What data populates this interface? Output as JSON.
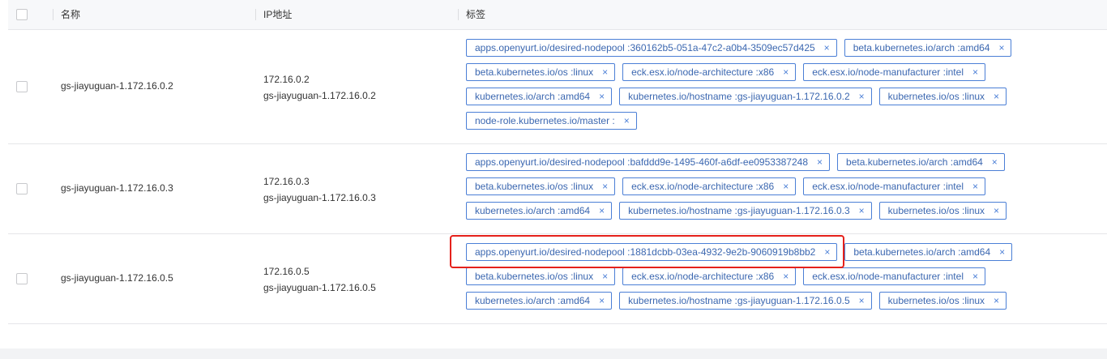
{
  "header": {
    "col_name": "名称",
    "col_ip": "IP地址",
    "col_tags": "标签"
  },
  "rows": [
    {
      "name": "gs-jiayuguan-1.172.16.0.2",
      "ip": "172.16.0.2",
      "hostname": "gs-jiayuguan-1.172.16.0.2",
      "tags": [
        "apps.openyurt.io/desired-nodepool :360162b5-051a-47c2-a0b4-3509ec57d425",
        "beta.kubernetes.io/arch :amd64",
        "beta.kubernetes.io/os :linux",
        "eck.esx.io/node-architecture :x86",
        "eck.esx.io/node-manufacturer :intel",
        "kubernetes.io/arch :amd64",
        "kubernetes.io/hostname :gs-jiayuguan-1.172.16.0.2",
        "kubernetes.io/os :linux",
        "node-role.kubernetes.io/master :"
      ]
    },
    {
      "name": "gs-jiayuguan-1.172.16.0.3",
      "ip": "172.16.0.3",
      "hostname": "gs-jiayuguan-1.172.16.0.3",
      "tags": [
        "apps.openyurt.io/desired-nodepool :bafddd9e-1495-460f-a6df-ee0953387248",
        "beta.kubernetes.io/arch :amd64",
        "beta.kubernetes.io/os :linux",
        "eck.esx.io/node-architecture :x86",
        "eck.esx.io/node-manufacturer :intel",
        "kubernetes.io/arch :amd64",
        "kubernetes.io/hostname :gs-jiayuguan-1.172.16.0.3",
        "kubernetes.io/os :linux"
      ]
    },
    {
      "name": "gs-jiayuguan-1.172.16.0.5",
      "ip": "172.16.0.5",
      "hostname": "gs-jiayuguan-1.172.16.0.5",
      "tags": [
        "apps.openyurt.io/desired-nodepool :1881dcbb-03ea-4932-9e2b-9060919b8bb2",
        "beta.kubernetes.io/arch :amd64",
        "beta.kubernetes.io/os :linux",
        "eck.esx.io/node-architecture :x86",
        "eck.esx.io/node-manufacturer :intel",
        "kubernetes.io/arch :amd64",
        "kubernetes.io/hostname :gs-jiayuguan-1.172.16.0.5",
        "kubernetes.io/os :linux"
      ]
    }
  ],
  "tag_close_glyph": "×",
  "colors": {
    "tag_border": "#4b7fd6",
    "tag_text": "#3b67b0",
    "highlight": "#e5211b"
  }
}
